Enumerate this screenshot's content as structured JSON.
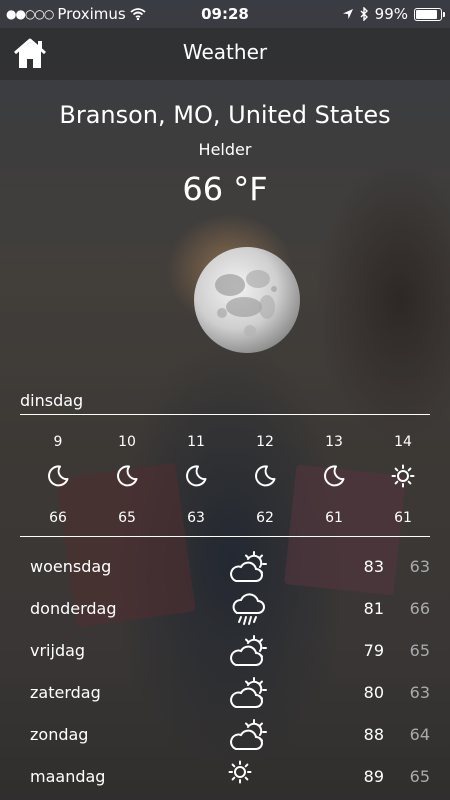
{
  "status_bar": {
    "signal_dots": "●●○○○",
    "carrier": "Proximus",
    "time": "09:28",
    "battery": "99%",
    "battery_level": 0.99
  },
  "nav": {
    "title": "Weather"
  },
  "current": {
    "location": "Branson, MO, United States",
    "condition": "Helder",
    "temperature": "66 °F"
  },
  "today": {
    "day": "dinsdag",
    "hours": [
      {
        "hour": "9",
        "icon": "moon-icon",
        "temp": "66"
      },
      {
        "hour": "10",
        "icon": "moon-icon",
        "temp": "65"
      },
      {
        "hour": "11",
        "icon": "moon-icon",
        "temp": "63"
      },
      {
        "hour": "12",
        "icon": "moon-icon",
        "temp": "62"
      },
      {
        "hour": "13",
        "icon": "moon-icon",
        "temp": "61"
      },
      {
        "hour": "14",
        "icon": "sun-icon",
        "temp": "61"
      }
    ]
  },
  "forecast": [
    {
      "day": "woensdag",
      "icon": "partly-sunny-cloud-icon",
      "high": "83",
      "low": "63"
    },
    {
      "day": "donderdag",
      "icon": "rain-cloud-icon",
      "high": "81",
      "low": "66"
    },
    {
      "day": "vrijdag",
      "icon": "partly-sunny-cloud-icon",
      "high": "79",
      "low": "65"
    },
    {
      "day": "zaterdag",
      "icon": "partly-sunny-cloud-icon",
      "high": "80",
      "low": "63"
    },
    {
      "day": "zondag",
      "icon": "partly-sunny-cloud-icon",
      "high": "88",
      "low": "64"
    },
    {
      "day": "maandag",
      "icon": "sun-icon",
      "high": "89",
      "low": "65"
    }
  ]
}
